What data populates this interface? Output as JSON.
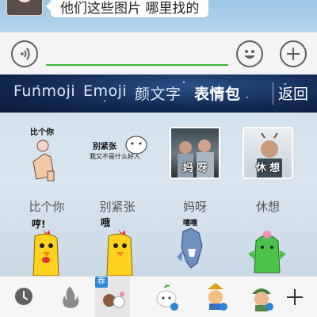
{
  "chat": {
    "message_text": "他们这些图片 哪里找的"
  },
  "input_bar": {
    "voice_icon": "voice-icon",
    "text_value": "",
    "emoji_icon": "emoji-face-icon",
    "more_icon": "plus-icon"
  },
  "sticker_panel": {
    "tabs": [
      {
        "label": "Funmoji"
      },
      {
        "label": "Emoji"
      },
      {
        "label": "颜文字"
      },
      {
        "label": "表情包"
      }
    ],
    "active_tab": "表情包",
    "back_label": "返回",
    "stickers": [
      {
        "label": "比个你",
        "caption": "比个你"
      },
      {
        "label": "别紧张",
        "caption": "别紧张",
        "subcaption": "我又不是什么好人"
      },
      {
        "label": "妈呀",
        "caption": "妈 呀"
      },
      {
        "label": "休想",
        "caption": "休 想"
      },
      {
        "caption": "哼!"
      },
      {
        "caption": "哦"
      },
      {
        "caption": "嘻嘻"
      },
      {
        "caption": ""
      }
    ],
    "bottom_items": [
      {
        "icon": "clock-icon"
      },
      {
        "icon": "fire-icon"
      },
      {
        "icon": "bear-sticker-pack-icon",
        "badge": "荐"
      },
      {
        "icon": "bun-sticker-pack-icon"
      },
      {
        "icon": "character-sticker-pack-icon"
      },
      {
        "icon": "soldier-sticker-pack-icon"
      },
      {
        "icon": "plus-icon"
      }
    ]
  },
  "colors": {
    "accent_green": "#45b537",
    "tab_bar_bg": "#132a55",
    "badge_blue": "#2b87d8"
  }
}
